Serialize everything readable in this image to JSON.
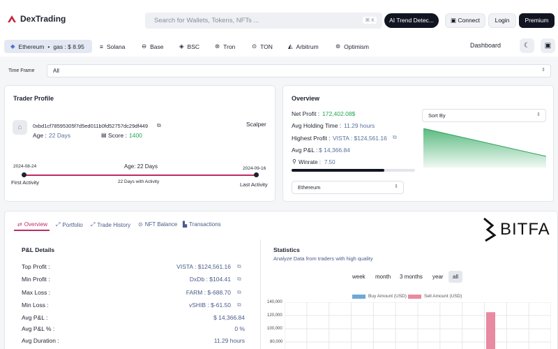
{
  "app": {
    "name": "DexTrading"
  },
  "search": {
    "placeholder": "Search for Wallets, Tokens, NFTs ...",
    "shortcut": "⌘ K"
  },
  "header": {
    "ai_button": "AI Trend Detec...",
    "connect": "Connect",
    "login": "Login",
    "premium": "Premium"
  },
  "chains": [
    {
      "label": "Ethereum",
      "extra": "gas : $ 8.95"
    },
    {
      "label": "Solana"
    },
    {
      "label": "Base"
    },
    {
      "label": "BSC"
    },
    {
      "label": "Tron"
    },
    {
      "label": "TON"
    },
    {
      "label": "Arbitrum"
    },
    {
      "label": "Optimism"
    }
  ],
  "dashboard": "Dashboard",
  "timeframe": {
    "label": "Time Frame",
    "value": "All"
  },
  "trader": {
    "title": "Trader Profile",
    "address": "0xbd1cf78595305f7d5ed011b0fd52757dc29df449",
    "tag": "Scalper",
    "age_label": "Age :",
    "age_value": "22 Days",
    "score_label": "Score :",
    "score_value": "1400",
    "start_date": "2024-08-24",
    "end_date": "2024-09-16",
    "age_center": "Age: 22 Days",
    "first_activity": "First Activity",
    "activity_days": "22 Days with Activity",
    "last_activity": "Last Activity"
  },
  "overview": {
    "title": "Overview",
    "net_profit_label": "Net Profit :",
    "net_profit_value": "172,402.08$",
    "avg_hold_label": "Avg Holding Time :",
    "avg_hold_value": "11.29 hours",
    "highest_label": "Highest Profit :",
    "highest_value": "VISTA : $124,561.16",
    "avg_pnl_label": "Avg P&L :",
    "avg_pnl_value": "$ 14,366.84",
    "winrate_label": "Winrate :",
    "winrate_value": "7.50",
    "winrate_fraction": 0.75,
    "chain_select": "Ethereum",
    "sort_select": "Sort By"
  },
  "tabs": [
    {
      "label": "Overview"
    },
    {
      "label": "Portfolio"
    },
    {
      "label": "Trade History"
    },
    {
      "label": "NFT Balance"
    },
    {
      "label": "Transactions"
    }
  ],
  "brand_logo": "BITFA",
  "pnl": {
    "title": "P&L Details",
    "rows": [
      {
        "label": "Top Profit :",
        "value": "VISTA : $124,561.16"
      },
      {
        "label": "Min Profit :",
        "value": "DxDb : $104.41"
      },
      {
        "label": "Max Loss :",
        "value": "FARM : $-688.70"
      },
      {
        "label": "Min Loss :",
        "value": "vSHIB : $-61.50"
      },
      {
        "label": "Avg P&L :",
        "value": "$ 14,366.84"
      },
      {
        "label": "Avg P&L % :",
        "value": "0 %"
      },
      {
        "label": "Avg Duration :",
        "value": "11.29 hours"
      }
    ]
  },
  "statistics": {
    "title": "Statistics",
    "subtitle": "Analyze Data from traders with high quality",
    "periods": [
      "week",
      "month",
      "3 months",
      "year",
      "all"
    ],
    "active_period": "all"
  },
  "chart_data": {
    "type": "bar",
    "series": [
      {
        "name": "Buy Amount (USD)",
        "color": "#6fa8d6",
        "values": [
          0
        ]
      },
      {
        "name": "Sell Amount (USD)",
        "color": "#e88aa0",
        "values": [
          125000
        ]
      }
    ],
    "y_ticks": [
      "140,000",
      "120,000",
      "100,000",
      "80,000"
    ],
    "ylim": [
      80000,
      140000
    ],
    "legend": "top"
  },
  "colors": {
    "accent": "#c02a63",
    "green": "#21a651",
    "dark": "#111522"
  }
}
